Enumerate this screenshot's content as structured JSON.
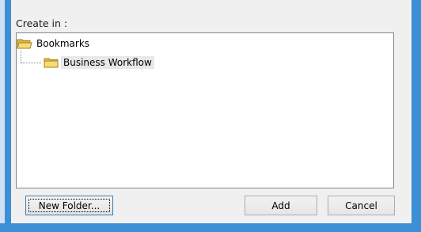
{
  "dialog": {
    "create_in_label": "Create in :"
  },
  "tree": {
    "nodes": [
      {
        "label": "Bookmarks",
        "icon": "folder-open-icon",
        "level": 0
      },
      {
        "label": "Business Workflow",
        "icon": "folder-icon",
        "level": 1
      }
    ]
  },
  "buttons": {
    "new_folder": "New Folder...",
    "add": "Add",
    "cancel": "Cancel"
  },
  "colors": {
    "window_frame": "#3c8fd6",
    "folder_yellow": "#f5d66b",
    "selection_bg": "#e8e8e8"
  }
}
